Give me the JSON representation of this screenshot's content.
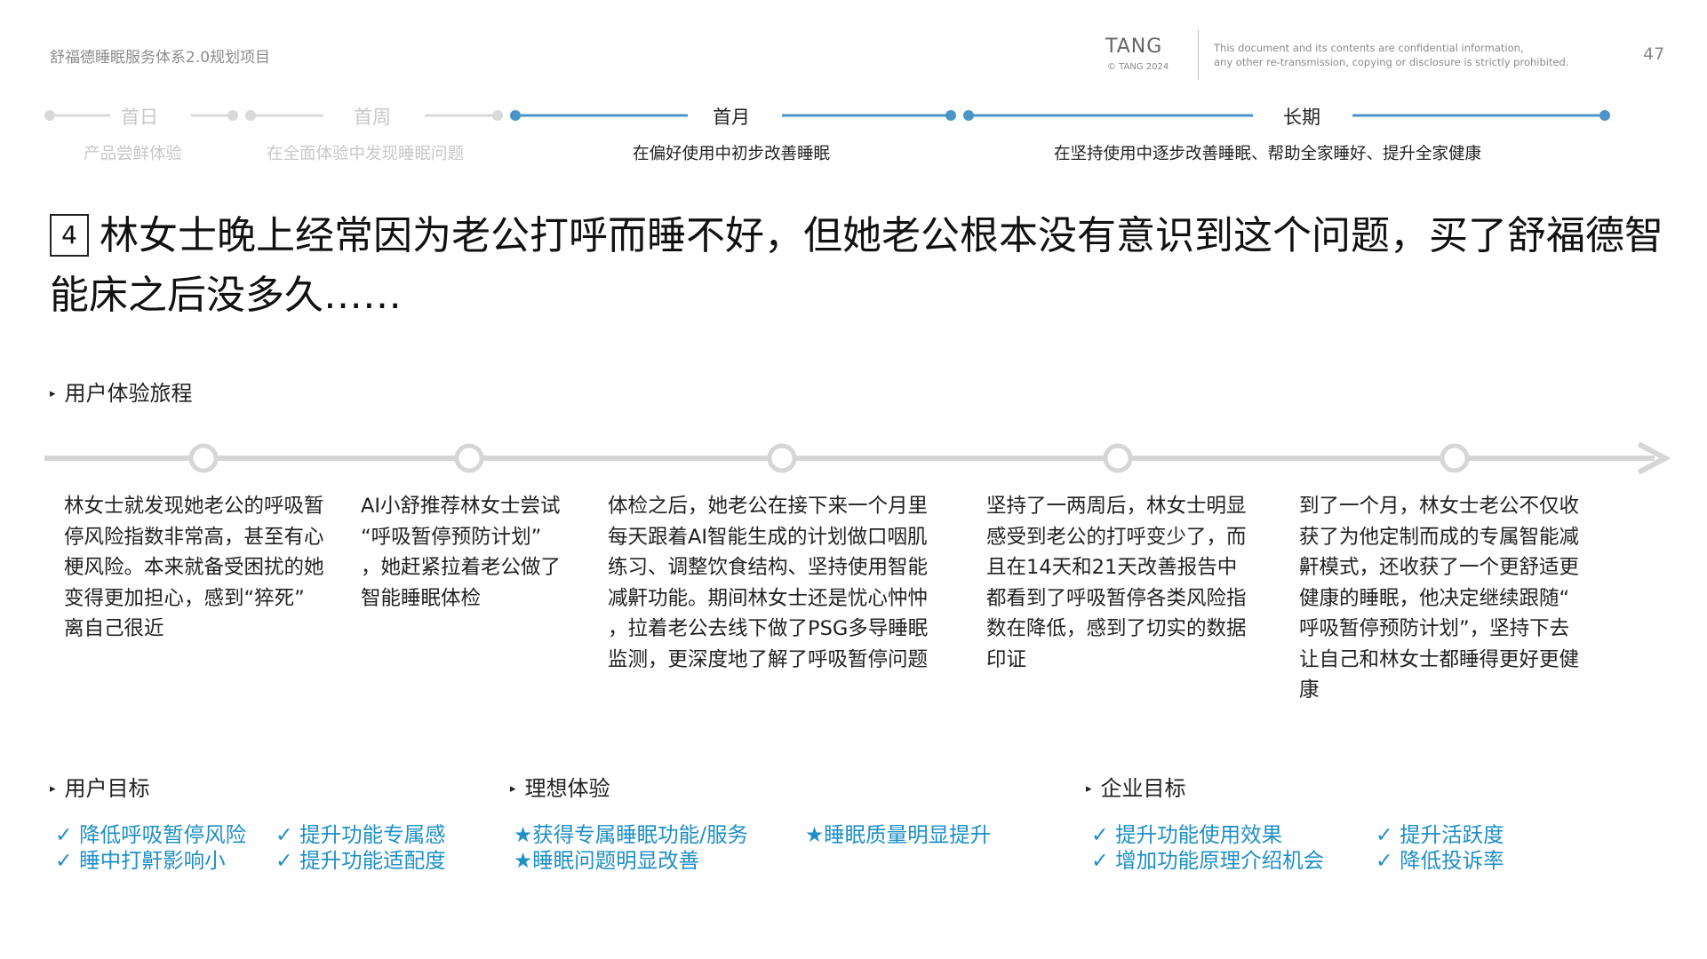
{
  "header": {
    "project_title": "舒福德睡眠服务体系2.0规划项目",
    "brand": "TANG",
    "brand_sub": "© TANG 2024",
    "confidential_line1": "This document and its contents are confidential information,",
    "confidential_line2": "any other re-transmission, copying or disclosure is strictly prohibited.",
    "page_number": "47"
  },
  "phases": [
    {
      "label": "首日",
      "sub": "产品尝鲜体验",
      "active": false
    },
    {
      "label": "首周",
      "sub": "在全面体验中发现睡眠问题",
      "active": false
    },
    {
      "label": "首月",
      "sub": "在偏好使用中初步改善睡眠",
      "active": true
    },
    {
      "label": "长期",
      "sub": "在坚持使用中逐步改善睡眠、帮助全家睡好、提升全家健康",
      "active": true
    }
  ],
  "colors": {
    "accent": "#4a94c8",
    "goal": "#1f8fc6",
    "inactive": "#d9d9d9",
    "timeline": "#d6d6d6"
  },
  "scenario": {
    "number": "4",
    "title": "林女士晚上经常因为老公打呼而睡不好，但她老公根本没有意识到这个问题，买了舒福德智能床之后没多久……"
  },
  "journey": {
    "section_title": "用户体验旅程",
    "steps": [
      {
        "lines": [
          "林女士就发现她老公的呼吸暂",
          "停风险指数非常高，甚至有心",
          "梗风险。本来就备受困扰的她",
          "变得更加担心，感到“猝死”",
          "离自己很近"
        ]
      },
      {
        "lines": [
          "AI小舒推荐林女士尝试",
          "“呼吸暂停预防计划”",
          "，她赶紧拉着老公做了",
          "智能睡眠体检"
        ]
      },
      {
        "lines": [
          "体检之后，她老公在接下来一个月里",
          "每天跟着AI智能生成的计划做口咽肌",
          "练习、调整饮食结构、坚持使用智能",
          "减鼾功能。期间林女士还是忧心忡忡",
          "，拉着老公去线下做了PSG多导睡眠",
          "监测，更深度地了解了呼吸暂停问题"
        ]
      },
      {
        "lines": [
          "坚持了一两周后，林女士明显",
          "感受到老公的打呼变少了，而",
          "且在14天和21天改善报告中",
          "都看到了呼吸暂停各类风险指",
          "数在降低，感到了切实的数据",
          "印证"
        ]
      },
      {
        "lines": [
          "到了一个月，林女士老公不仅收",
          "获了为他定制而成的专属智能减",
          "鼾模式，还收获了一个更舒适更",
          "健康的睡眠，他决定继续跟随“",
          "呼吸暂停预防计划”，坚持下去",
          "让自己和林女士都睡得更好更健",
          "康"
        ]
      }
    ]
  },
  "user_goals": {
    "title": "用户目标",
    "items": [
      "✓ 降低呼吸暂停风险",
      "✓ 提升功能专属感",
      "✓ 睡中打鼾影响小",
      "✓ 提升功能适配度"
    ]
  },
  "ideal_experience": {
    "title": "理想体验",
    "items": [
      "★获得专属睡眠功能/服务",
      "★睡眠质量明显提升",
      "★睡眠问题明显改善"
    ]
  },
  "enterprise_goals": {
    "title": "企业目标",
    "items": [
      "✓ 提升功能使用效果",
      "✓ 提升活跃度",
      "✓ 增加功能原理介绍机会",
      "✓ 降低投诉率"
    ]
  }
}
